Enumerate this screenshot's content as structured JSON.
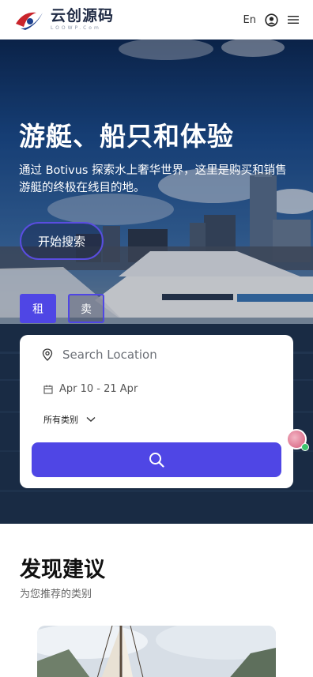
{
  "header": {
    "logo_title": "云创源码",
    "logo_subtitle": "LOOWP.Com",
    "lang_label": "En"
  },
  "hero": {
    "title": "游艇、船只和体验",
    "description": "通过 Botivus 探索水上奢华世界，这里是购买和销售游艇的终极在线目的地。",
    "start_button": "开始搜索",
    "tabs": [
      {
        "label": "租",
        "active": true
      },
      {
        "label": "卖",
        "active": false
      }
    ]
  },
  "search": {
    "location_placeholder": "Search Location",
    "date_range": "Apr 10 - 21 Apr",
    "category_label": "所有类别"
  },
  "discover": {
    "title": "发现建议",
    "subtitle": "为您推荐的类别"
  },
  "colors": {
    "accent": "#4f46e5",
    "text_dark": "#111111",
    "text_muted": "#666666"
  },
  "icons": {
    "location": "location-pin-icon",
    "calendar": "calendar-icon",
    "chevron": "chevron-down-icon",
    "search": "search-icon",
    "user": "user-circle-icon",
    "menu": "menu-icon"
  }
}
